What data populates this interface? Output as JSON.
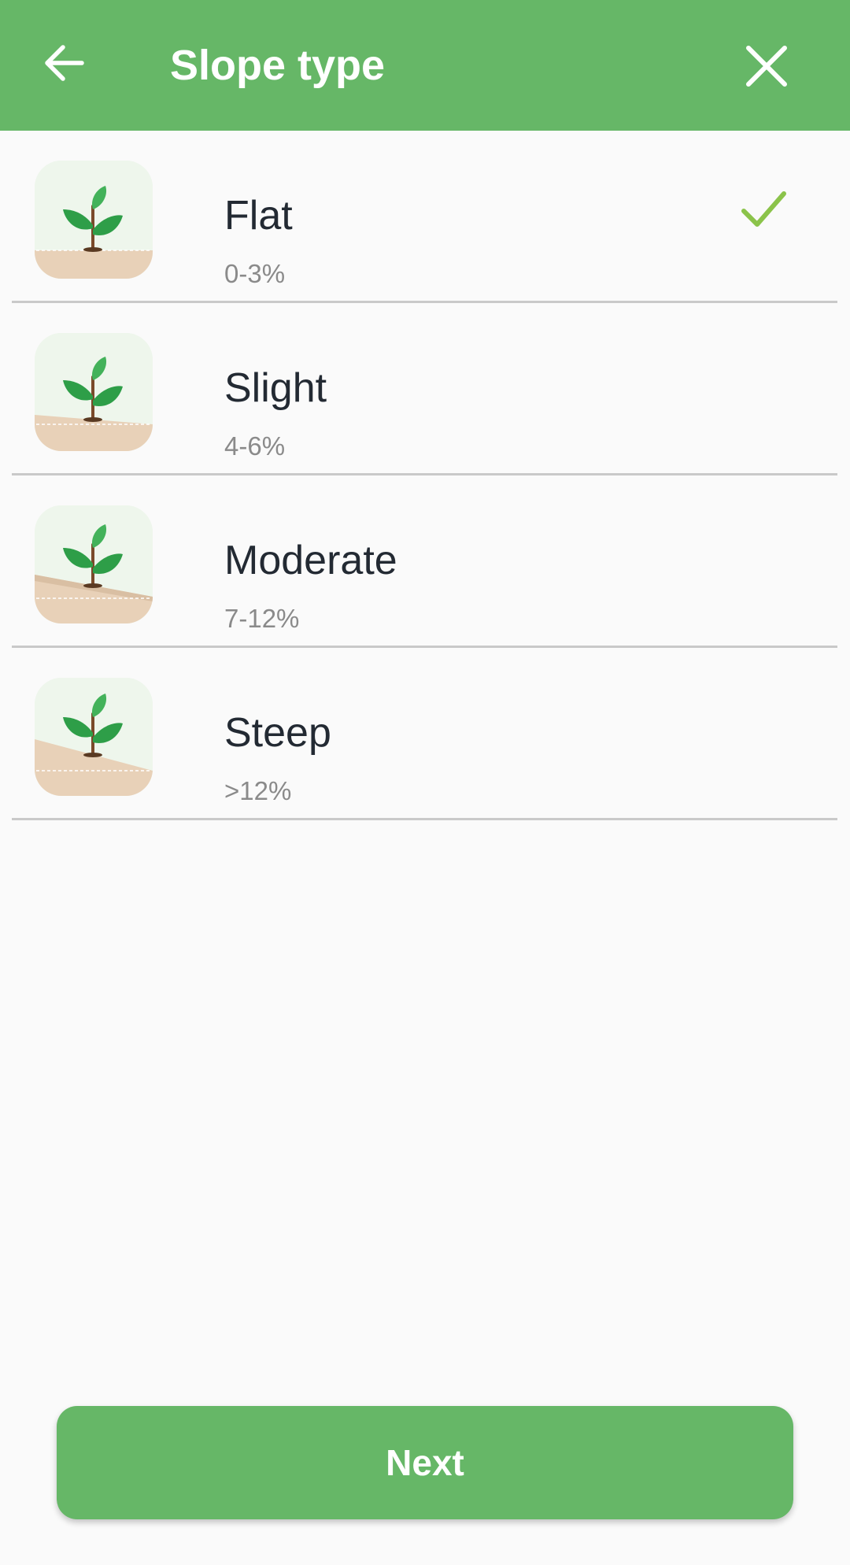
{
  "header": {
    "title": "Slope type",
    "back_icon": "arrow-left-icon",
    "close_icon": "close-icon",
    "background_color": "#66b767"
  },
  "slopes": [
    {
      "label": "Flat",
      "range": "0-3%",
      "selected": true,
      "icon": "plant-flat-slope-icon"
    },
    {
      "label": "Slight",
      "range": "4-6%",
      "selected": false,
      "icon": "plant-slight-slope-icon"
    },
    {
      "label": "Moderate",
      "range": "7-12%",
      "selected": false,
      "icon": "plant-moderate-slope-icon"
    },
    {
      "label": "Steep",
      "range": ">12%",
      "selected": false,
      "icon": "plant-steep-slope-icon"
    }
  ],
  "selected_check_icon": "checkmark-icon",
  "accent_color": "#8bc34a",
  "footer": {
    "next_label": "Next"
  }
}
